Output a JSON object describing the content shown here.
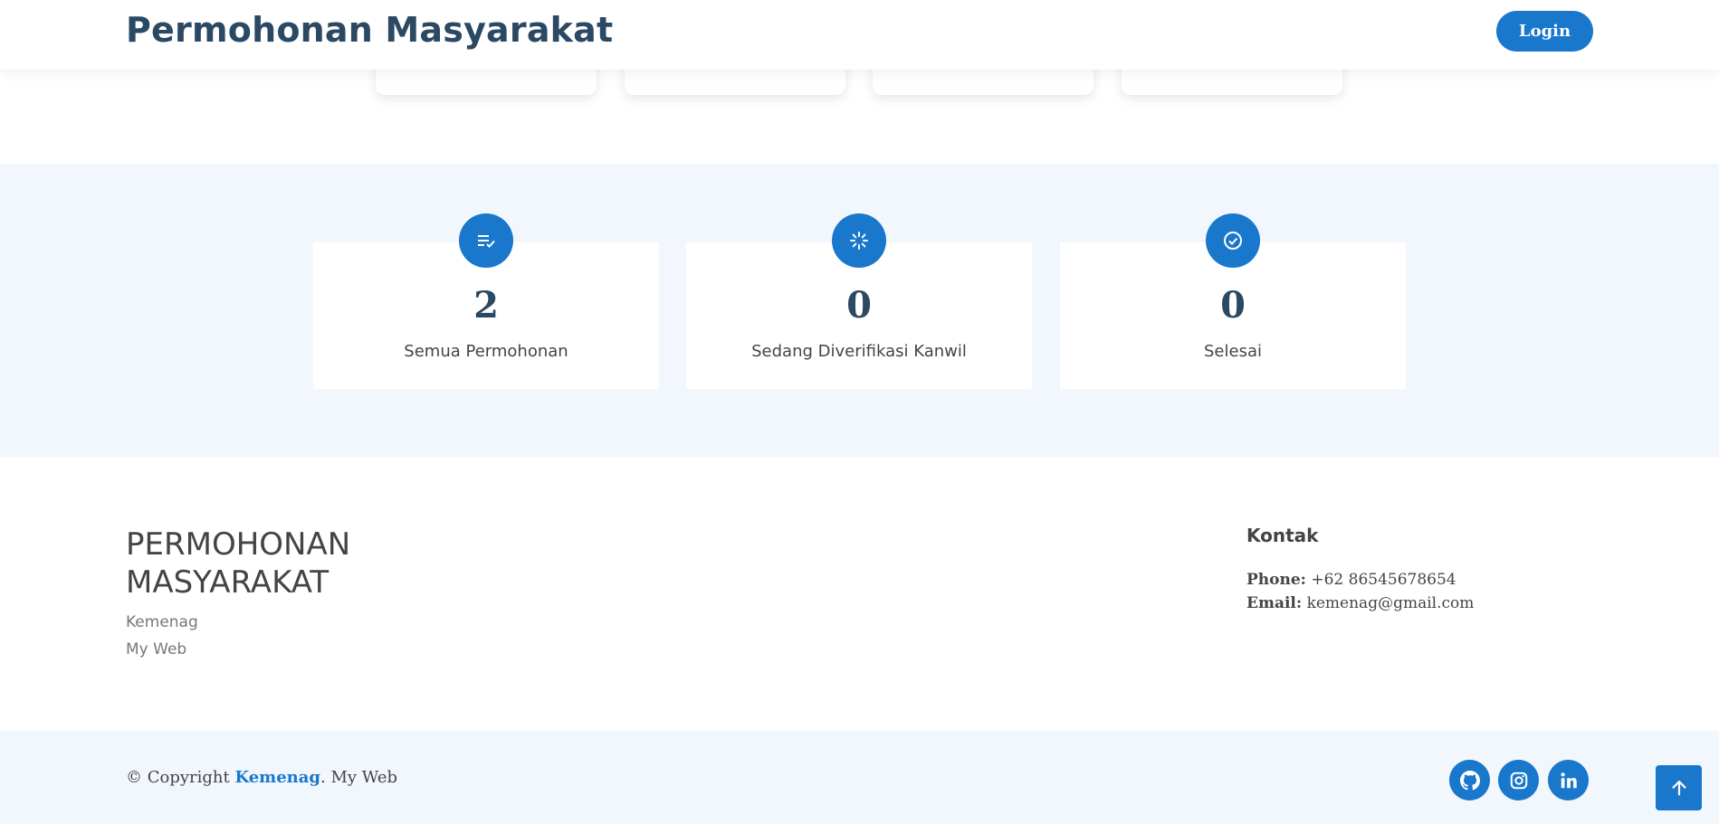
{
  "header": {
    "brand": "Permohonan Masyarakat",
    "login_label": "Login"
  },
  "stats": [
    {
      "icon": "list-check-icon",
      "value": "2",
      "label": "Semua Permohonan"
    },
    {
      "icon": "loading-icon",
      "value": "0",
      "label": "Sedang Diverifikasi Kanwil"
    },
    {
      "icon": "check-circle-icon",
      "value": "0",
      "label": "Selesai"
    }
  ],
  "footer": {
    "title": "PERMOHONAN MASYARAKAT",
    "sub1": "Kemenag",
    "sub2": "My Web",
    "contact_title": "Kontak",
    "phone_label": "Phone:",
    "phone": "+62 86545678654",
    "email_label": "Email:",
    "email": "kemenag@gmail.com"
  },
  "copyright": {
    "prefix": "© Copyright",
    "brand": "Kemenag",
    "suffix": ". My Web"
  },
  "social": [
    "github-icon",
    "instagram-icon",
    "linkedin-icon"
  ],
  "colors": {
    "primary": "#1977cc",
    "heading": "#2c4964",
    "section_bg": "#f1f7fd"
  }
}
